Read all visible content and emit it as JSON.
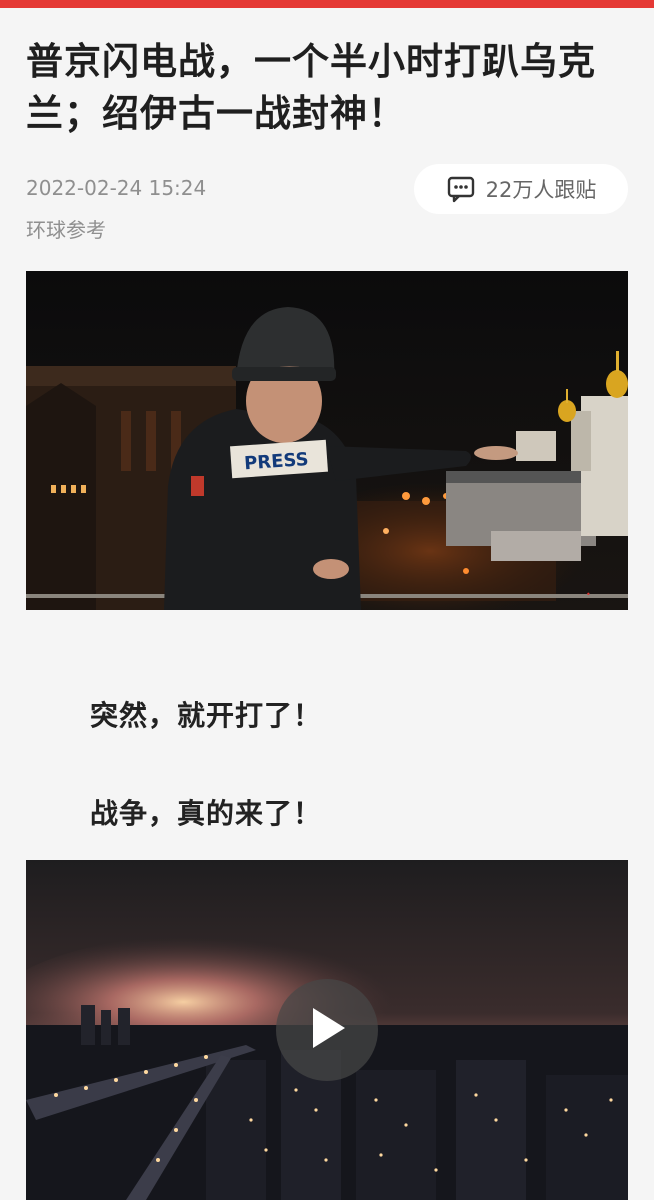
{
  "article": {
    "title": "普京闪电战，一个半小时打趴乌克兰；绍伊古一战封神！",
    "date": "2022-02-24 15:24",
    "source": "环球参考",
    "comments_label": "22万人跟贴",
    "paragraphs": [
      "突然，就开打了！",
      "战争，真的来了！"
    ]
  },
  "media": {
    "image1": {
      "badge_text": "PRESS"
    },
    "video": {
      "play_icon": "play-icon"
    }
  },
  "colors": {
    "accent": "#e53935",
    "title": "#1f1f1f",
    "meta": "#8f8f8f",
    "background": "#f5f5f5"
  }
}
